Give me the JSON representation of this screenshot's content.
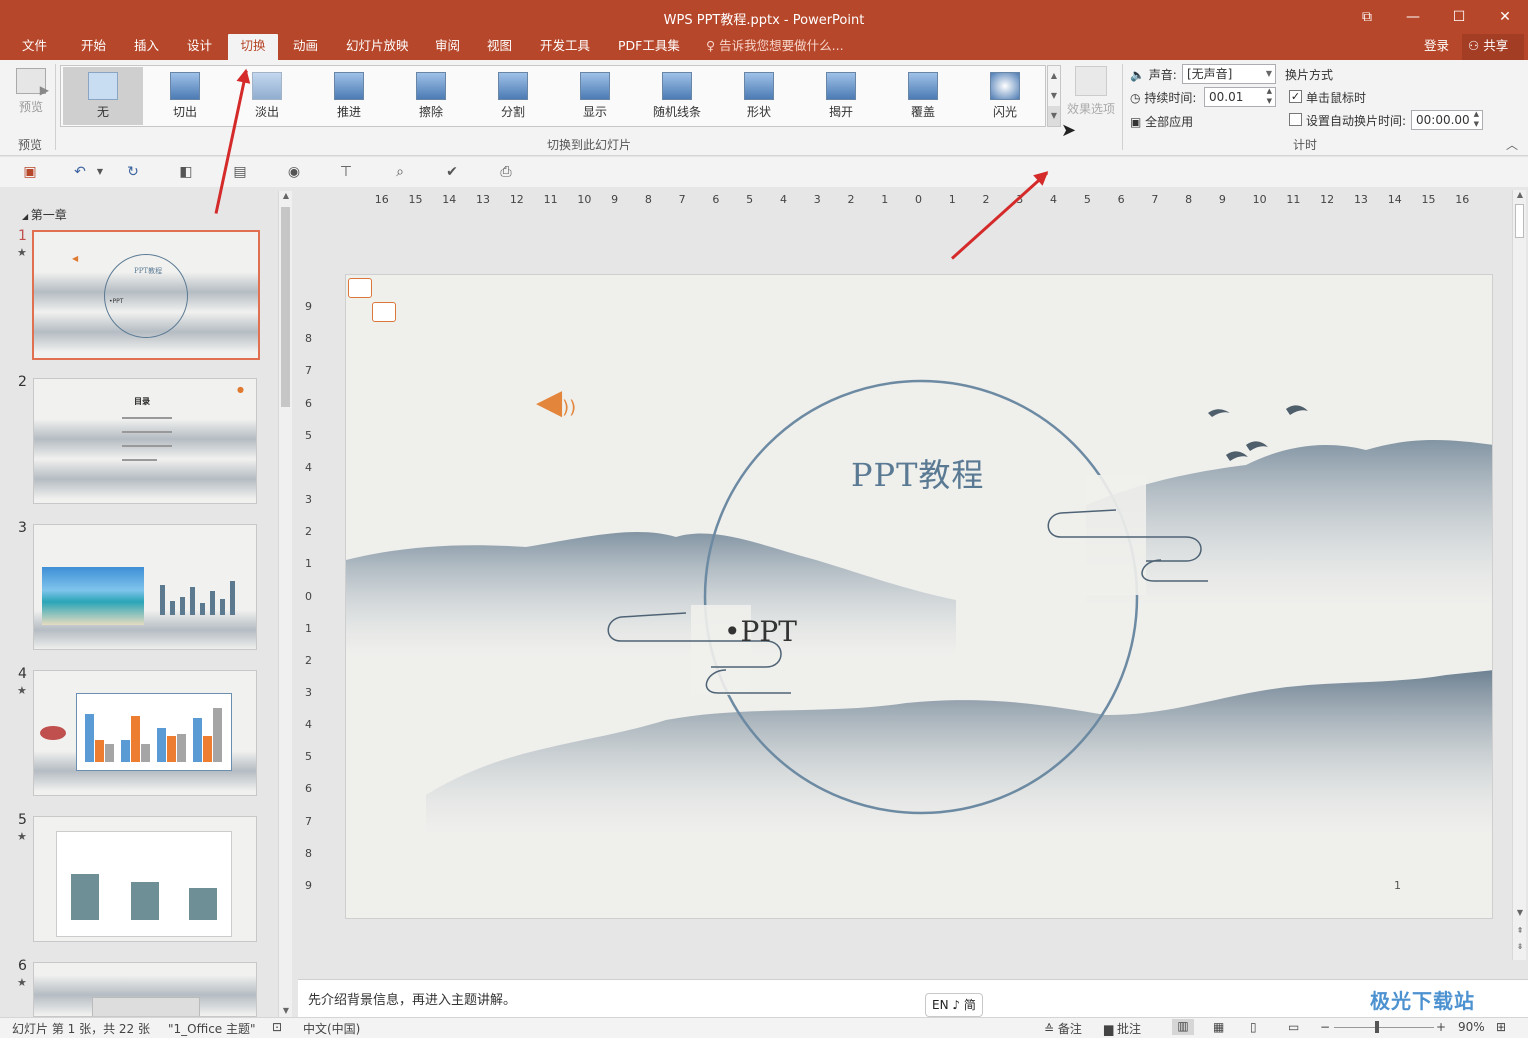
{
  "window": {
    "title": "WPS PPT教程.pptx - PowerPoint"
  },
  "menu": {
    "tabs": [
      "文件",
      "开始",
      "插入",
      "设计",
      "切换",
      "动画",
      "幻灯片放映",
      "审阅",
      "视图",
      "开发工具",
      "PDF工具集"
    ],
    "active_tab": "切换",
    "tell_me": "告诉我您想要做什么...",
    "login": "登录",
    "share": "共享"
  },
  "ribbon": {
    "preview_label": "预览",
    "preview_group": "预览",
    "transitions": [
      "无",
      "切出",
      "淡出",
      "推进",
      "擦除",
      "分割",
      "显示",
      "随机线条",
      "形状",
      "揭开",
      "覆盖",
      "闪光"
    ],
    "selected_transition": "无",
    "transitions_group": "切换到此幻灯片",
    "effect_options": "效果选项",
    "sound_label": "声音:",
    "sound_value": "[无声音]",
    "duration_label": "持续时间:",
    "duration_value": "00.01",
    "apply_all": "全部应用",
    "advance_header": "换片方式",
    "on_click": "单击鼠标时",
    "on_click_checked": true,
    "after_time": "设置自动换片时间:",
    "after_time_checked": false,
    "after_time_value": "00:00.00",
    "timing_group": "计时"
  },
  "thumbnails": {
    "section": "第一章",
    "slides": [
      {
        "num": "1",
        "star": true,
        "title": "PPT教程",
        "subtitle": "•PPT"
      },
      {
        "num": "2",
        "star": false,
        "title": "目录"
      },
      {
        "num": "3",
        "star": false,
        "title": ""
      },
      {
        "num": "4",
        "star": true,
        "title": ""
      },
      {
        "num": "5",
        "star": true,
        "title": ""
      },
      {
        "num": "6",
        "star": true,
        "title": ""
      }
    ]
  },
  "ruler": {
    "h_labels": [
      "16",
      "15",
      "14",
      "13",
      "12",
      "11",
      "10",
      "9",
      "8",
      "7",
      "6",
      "5",
      "4",
      "3",
      "2",
      "1",
      "0",
      "1",
      "2",
      "3",
      "4",
      "5",
      "6",
      "7",
      "8",
      "9",
      "10",
      "11",
      "12",
      "13",
      "14",
      "15",
      "16"
    ],
    "v_labels": [
      "9",
      "8",
      "7",
      "6",
      "5",
      "4",
      "3",
      "2",
      "1",
      "0",
      "1",
      "2",
      "3",
      "4",
      "5",
      "6",
      "7",
      "8",
      "9"
    ]
  },
  "slide": {
    "title": "PPT教程",
    "subtitle": "•PPT",
    "page_number": "1"
  },
  "notes": {
    "text": "先介绍背景信息，再进入主题讲解。"
  },
  "ime": {
    "text": "EN ♪ 简"
  },
  "status": {
    "slide_info": "幻灯片 第 1 张，共 22 张",
    "theme": "\"1_Office 主题\"",
    "language": "中文(中国)",
    "notes_btn": "备注",
    "comments_btn": "批注",
    "zoom": "90%"
  },
  "watermark": "极光下载站",
  "colors": {
    "accent": "#b7472a",
    "slide_ink": "#5a7a94",
    "annotation_arrow": "#d42a2a"
  }
}
